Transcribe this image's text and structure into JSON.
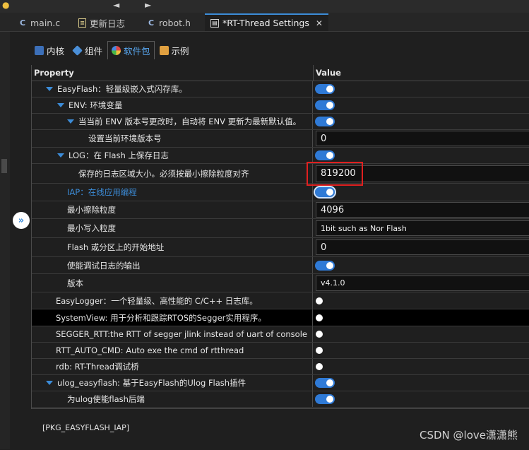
{
  "tabs": [
    {
      "label": "main.c",
      "icon": "c-file-icon"
    },
    {
      "label": "更新日志",
      "icon": "doc-file-icon"
    },
    {
      "label": "robot.h",
      "icon": "c-file-icon"
    },
    {
      "label": "*RT-Thread Settings",
      "icon": "settings-file-icon"
    }
  ],
  "subtabs": [
    {
      "label": "内核",
      "icon": "kernel-icon"
    },
    {
      "label": "组件",
      "icon": "component-icon"
    },
    {
      "label": "软件包",
      "icon": "package-icon"
    },
    {
      "label": "示例",
      "icon": "example-icon"
    }
  ],
  "table": {
    "header_property": "Property",
    "header_value": "Value",
    "rows": [
      {
        "label": "EasyFlash：轻量级嵌入式闪存库。",
        "value": "",
        "expanded": true
      },
      {
        "label": "ENV: 环境变量",
        "value": "",
        "expanded": true
      },
      {
        "label": "当当前 ENV 版本号更改时，自动将 ENV 更新为最新默认值。",
        "value": "",
        "expanded": true
      },
      {
        "label": "设置当前环境版本号",
        "value": "0"
      },
      {
        "label": "LOG：在 Flash 上保存日志",
        "value": "",
        "expanded": true
      },
      {
        "label": "保存的日志区域大小。必须按最小擦除粒度对齐",
        "value": "819200"
      },
      {
        "label": "IAP：在线应用编程",
        "value": ""
      },
      {
        "label": "最小擦除粒度",
        "value": "4096"
      },
      {
        "label": "最小写入粒度",
        "value": "1bit such as Nor Flash"
      },
      {
        "label": "Flash 或分区上的开始地址",
        "value": "0"
      },
      {
        "label": "使能调试日志的输出",
        "value": ""
      },
      {
        "label": "版本",
        "value": "v4.1.0"
      },
      {
        "label": "EasyLogger：一个轻量级、高性能的 C/C++ 日志库。",
        "value": ""
      },
      {
        "label": "SystemView: 用于分析和跟踪RTOS的Segger实用程序。",
        "value": ""
      },
      {
        "label": "SEGGER_RTT:the RTT of segger jlink instead of uart of console",
        "value": ""
      },
      {
        "label": "RTT_AUTO_CMD: Auto exe the cmd of rtthread",
        "value": ""
      },
      {
        "label": "rdb: RT-Thread调试桥",
        "value": ""
      },
      {
        "label": "ulog_easyflash: 基于EasyFlash的Ulog Flash插件",
        "value": "",
        "expanded": true
      },
      {
        "label": "为ulog使能flash后端",
        "value": ""
      }
    ]
  },
  "footer": {
    "macro": "[PKG_EASYFLASH_IAP]"
  },
  "watermark": "CSDN @love潇潇熊",
  "colors": {
    "accent": "#2f7ad6",
    "highlight": "#e02020",
    "link": "#3c8cd8"
  }
}
